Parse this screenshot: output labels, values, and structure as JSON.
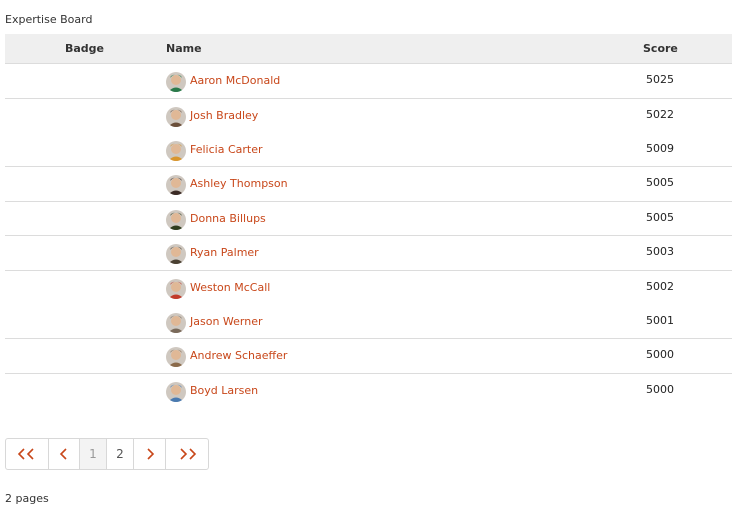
{
  "board": {
    "title": "Expertise Board"
  },
  "table": {
    "headers": {
      "badge": "Badge",
      "name": "Name",
      "score": "Score"
    },
    "rows": [
      {
        "name": "Aaron McDonald",
        "score": "5025",
        "avatar_color": "#2a7a4a"
      },
      {
        "name": "Josh Bradley",
        "score": "5022",
        "avatar_color": "#6b4f3a"
      },
      {
        "name": "Felicia Carter",
        "score": "5009",
        "avatar_color": "#d9962e"
      },
      {
        "name": "Ashley Thompson",
        "score": "5005",
        "avatar_color": "#3a2a24"
      },
      {
        "name": "Donna Billups",
        "score": "5005",
        "avatar_color": "#2f3d1e"
      },
      {
        "name": "Ryan Palmer",
        "score": "5003",
        "avatar_color": "#4a4032"
      },
      {
        "name": "Weston McCall",
        "score": "5002",
        "avatar_color": "#c23b2b"
      },
      {
        "name": "Jason Werner",
        "score": "5001",
        "avatar_color": "#7a6a5a"
      },
      {
        "name": "Andrew Schaeffer",
        "score": "5000",
        "avatar_color": "#8a6a4a"
      },
      {
        "name": "Boyd Larsen",
        "score": "5000",
        "avatar_color": "#4a7ab0"
      }
    ]
  },
  "pagination": {
    "first_label": "<<",
    "prev_label": "<",
    "pages": [
      "1",
      "2"
    ],
    "current_page": "1",
    "next_label": ">",
    "last_label": ">>",
    "summary": "2 pages"
  },
  "colors": {
    "link": "#c8471a",
    "header_bg": "#efefef"
  }
}
